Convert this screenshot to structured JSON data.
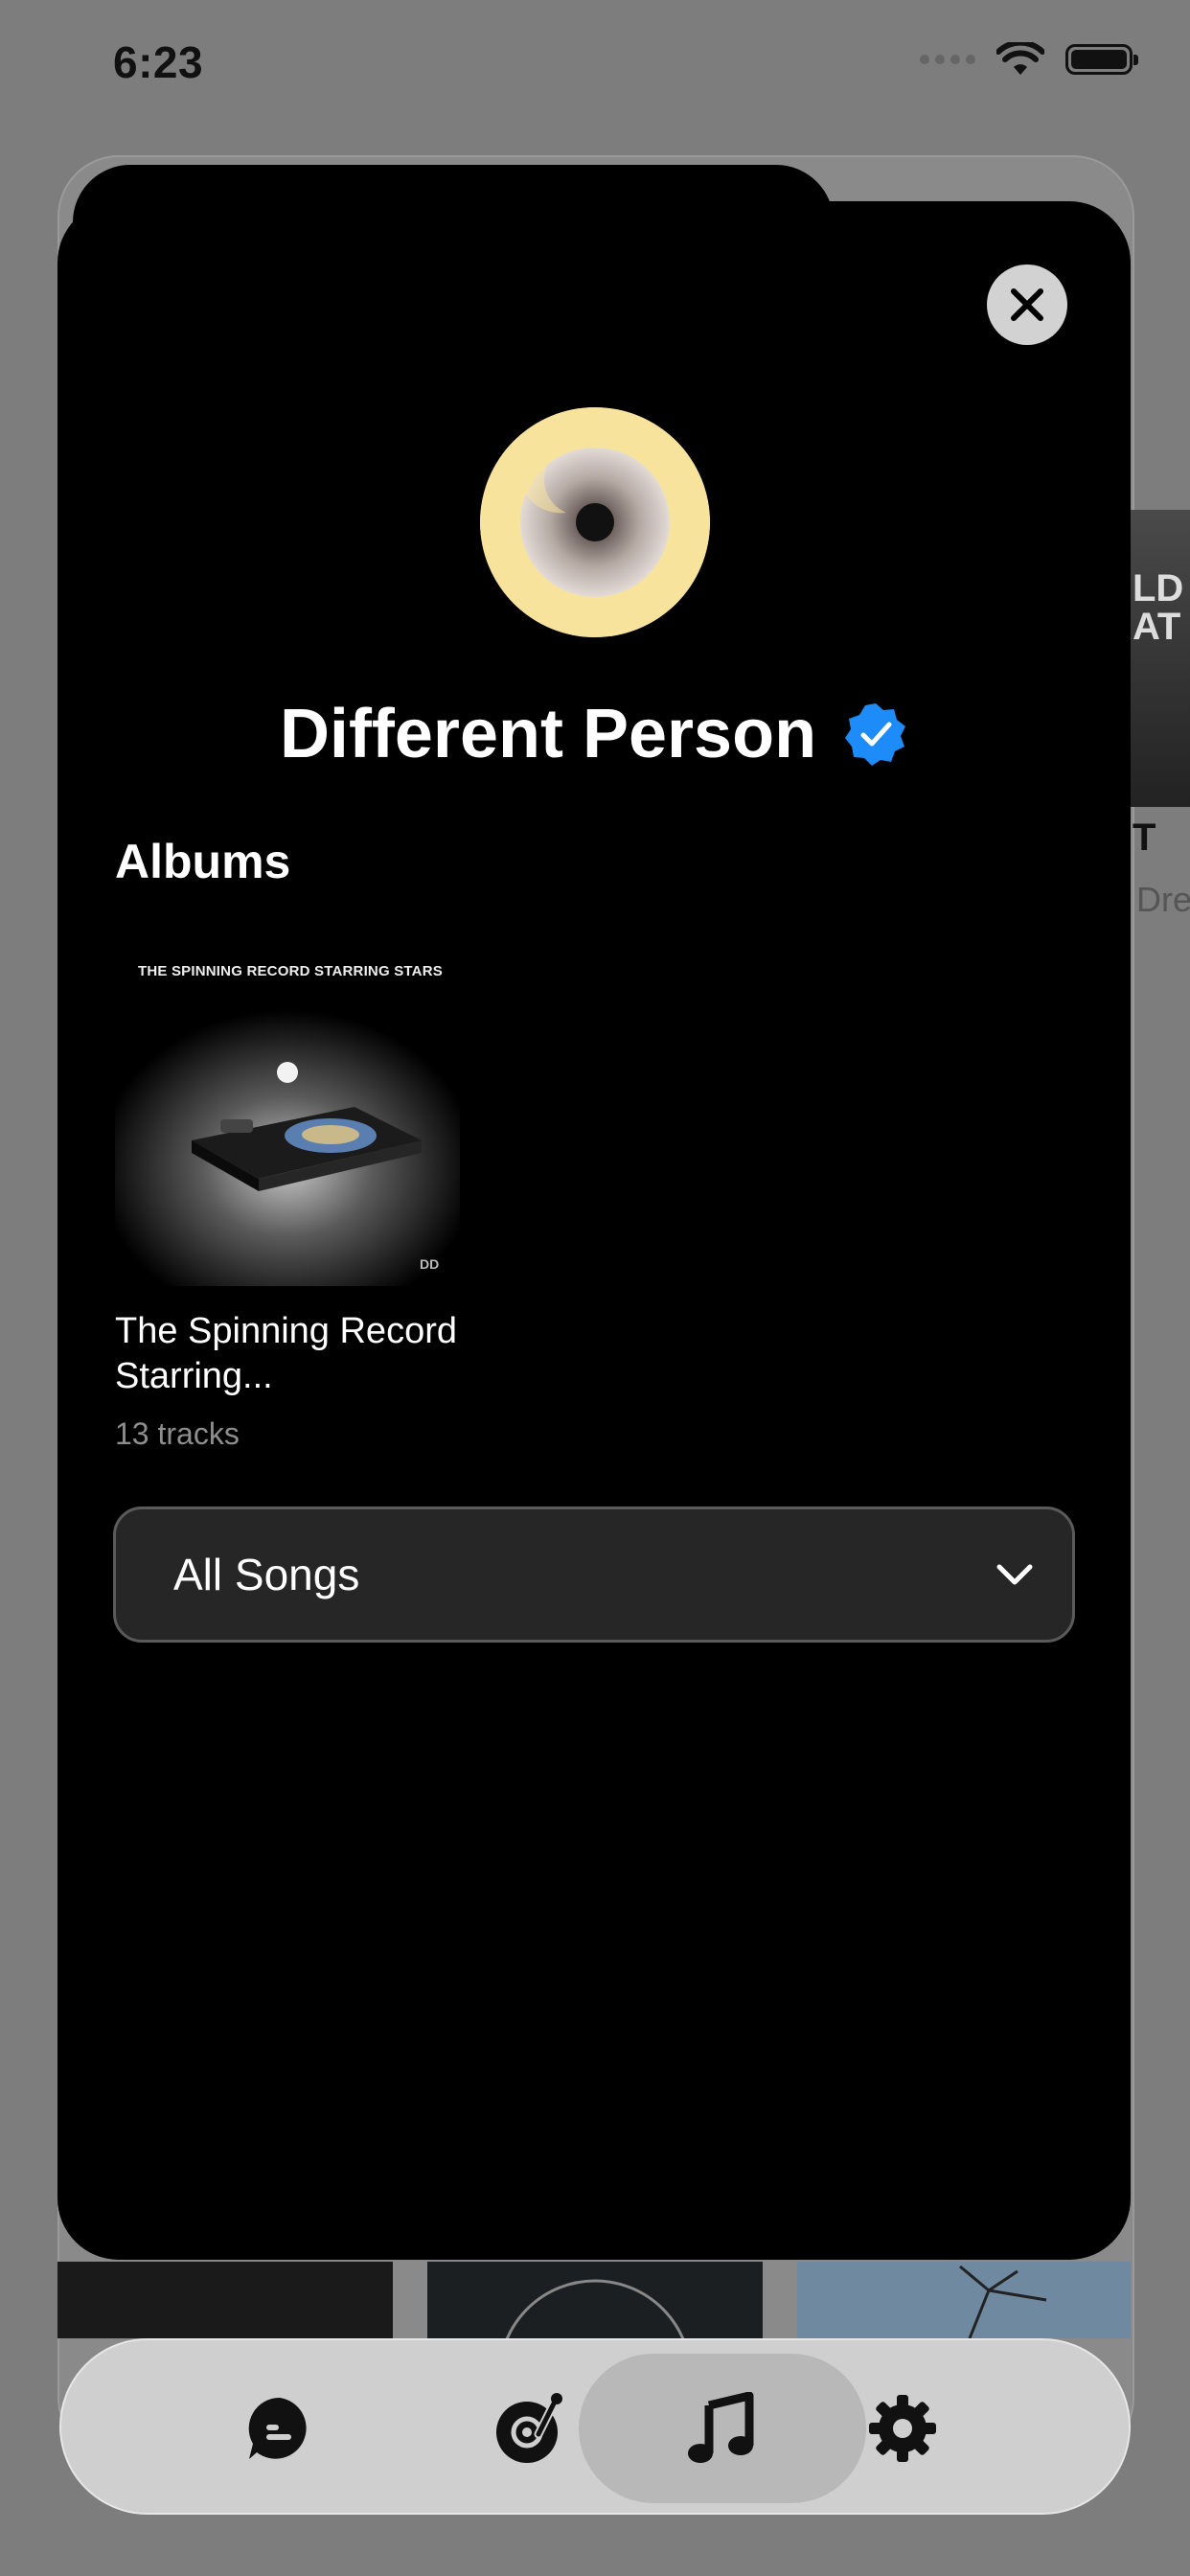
{
  "status_bar": {
    "time": "6:23"
  },
  "background": {
    "peek_art_text": [
      "LD",
      "AT"
    ],
    "peek_title": "T",
    "peek_subtitle": "Dre"
  },
  "modal": {
    "artist": {
      "name": "Different Person",
      "verified": true
    },
    "albums_section": {
      "title": "Albums",
      "albums": [
        {
          "cover_text": "THE SPINNING RECORD STARRING STARS",
          "title": "The Spinning Record Starring...",
          "tracks": "13 tracks"
        }
      ]
    },
    "songs_dropdown": {
      "selected": "All Songs"
    }
  },
  "tab_bar": {
    "tabs": [
      {
        "icon": "chat-bubble-icon",
        "active": false
      },
      {
        "icon": "record-player-icon",
        "active": false
      },
      {
        "icon": "music-note-icon",
        "active": true
      },
      {
        "icon": "gear-icon",
        "active": false
      }
    ]
  },
  "colors": {
    "verified_badge": "#1d8cf8",
    "avatar_bg": "#f7e39c",
    "modal_bg": "#000000",
    "dropdown_bg": "#262626"
  }
}
